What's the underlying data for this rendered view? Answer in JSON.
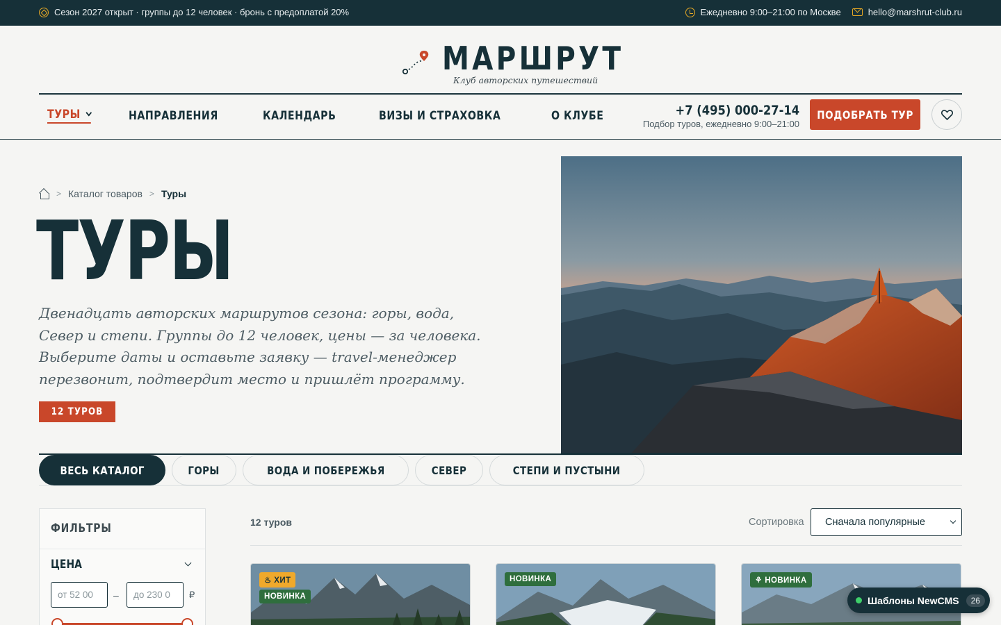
{
  "topbar": {
    "announcement": "Сезон 2027 открыт · группы до 12 человек · бронь с предоплатой 20%",
    "hours": "Ежедневно 9:00–21:00 по Москве",
    "email": "hello@marshrut-club.ru",
    "icons": [
      "compass-icon",
      "clock-icon",
      "mail-icon"
    ],
    "accent": "#e6a825"
  },
  "brand": {
    "name": "МАРШРУТ",
    "tagline": "Клуб авторских путешествий"
  },
  "nav": {
    "items": [
      {
        "label": "ТУРЫ",
        "active": true,
        "has_dropdown": true
      },
      {
        "label": "НАПРАВЛЕНИЯ"
      },
      {
        "label": "КАЛЕНДАРЬ"
      },
      {
        "label": "ВИЗЫ И СТРАХОВКА"
      },
      {
        "label": "О КЛУБЕ"
      }
    ]
  },
  "contact": {
    "phone": "+7 (495) 000-27-14",
    "phone_note": "Подбор туров, ежедневно 9:00–21:00",
    "cta_label": "ПОДОБРАТЬ ТУР"
  },
  "breadcrumb": {
    "items": [
      "Каталог товаров",
      "Туры"
    ]
  },
  "hero": {
    "title": "ТУРЫ",
    "description": "Двенадцать авторских маршрутов сезона: горы, вода, Север и степи. Группы до 12 человек, цены — за человека. Выберите даты и оставьте заявку — travel-менеджер перезвонит, подтвердит место и пришлёт программу.",
    "count_badge": "12 ТУРОВ"
  },
  "categories": {
    "tabs": [
      {
        "label": "ВЕСЬ КАТАЛОГ",
        "active": true
      },
      {
        "label": "ГОРЫ"
      },
      {
        "label": "ВОДА И ПОБЕРЕЖЬЯ"
      },
      {
        "label": "СЕВЕР"
      },
      {
        "label": "СТЕПИ И ПУСТЫНИ"
      }
    ]
  },
  "filters": {
    "title": "ФИЛЬТРЫ",
    "price": {
      "title": "ЦЕНА",
      "from_placeholder": "от  52 00",
      "to_placeholder": "до  230 0",
      "currency": "₽",
      "range_from": 0,
      "range_to": 1
    }
  },
  "results": {
    "count": "12 туров",
    "sort_label": "Сортировка",
    "sort_value": "Сначала популярные"
  },
  "cards": [
    {
      "badges": [
        {
          "label": "♨ ХИТ",
          "type": "hit"
        },
        {
          "label": "НОВИНКА",
          "type": "new"
        }
      ]
    },
    {
      "badges": [
        {
          "label": "НОВИНКА",
          "type": "new"
        }
      ]
    },
    {
      "badges": [
        {
          "label": "⚘ НОВИНКА",
          "type": "new"
        }
      ]
    }
  ],
  "widget": {
    "label": "Шаблоны NewCMS",
    "count": "26"
  },
  "colors": {
    "brand_dark": "#163038",
    "accent": "#c9472a",
    "hit": "#f0a92b",
    "new": "#2f6e3d"
  }
}
